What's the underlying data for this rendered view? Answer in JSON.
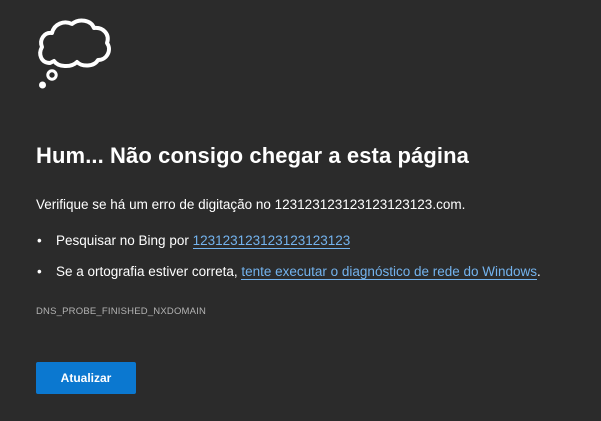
{
  "icon": "thought-cloud-icon",
  "title": "Hum... Não consigo chegar a esta página",
  "subtitle": "Verifique se há um erro de digitação no 12312312312312312312​3.com.",
  "suggestions": [
    {
      "prefix": "Pesquisar no Bing por ",
      "link": "12312312312312312312​3",
      "suffix": ""
    },
    {
      "prefix": "Se a ortografia estiver correta, ",
      "link": "tente executar o diagnóstico de rede do Windows",
      "suffix": "."
    }
  ],
  "error_code": "DNS_PROBE_FINISHED_NXDOMAIN",
  "refresh_label": "Atualizar",
  "colors": {
    "background": "#2b2b2b",
    "link": "#73b3ee",
    "button": "#0b78d0",
    "error_code": "#b3b3b3"
  }
}
